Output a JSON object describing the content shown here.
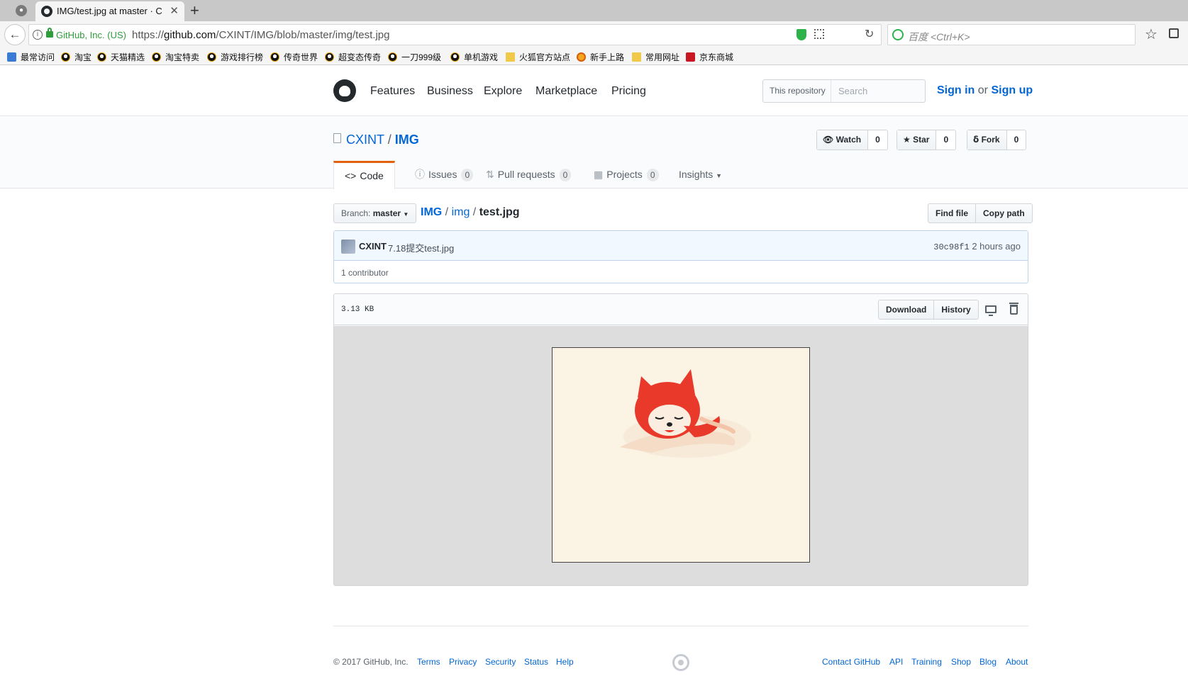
{
  "browser": {
    "tab_title": "IMG/test.jpg at master · C",
    "site_identity": "GitHub, Inc. (US)",
    "url_prefix": "https://",
    "url_host": "github.com",
    "url_path": "/CXINT/IMG/blob/master/img/test.jpg",
    "search_placeholder": "百度 <Ctrl+K>",
    "bookmarks": [
      "最常访问",
      "淘宝",
      "天猫精选",
      "淘宝特卖",
      "游戏排行榜",
      "传奇世界",
      "超变态传奇",
      "一刀999级",
      "单机游戏",
      "火狐官方站点",
      "新手上路",
      "常用网址",
      "京东商城"
    ]
  },
  "header": {
    "nav": [
      "Features",
      "Business",
      "Explore",
      "Marketplace",
      "Pricing"
    ],
    "search_scope": "This repository",
    "search_placeholder": "Search",
    "sign_in": "Sign in",
    "or": "or",
    "sign_up": "Sign up"
  },
  "repo": {
    "owner": "CXINT",
    "separator": "/",
    "name": "IMG",
    "watch_label": "Watch",
    "watch_count": "0",
    "star_label": "Star",
    "star_count": "0",
    "fork_label": "Fork",
    "fork_count": "0",
    "tabs": {
      "code": "Code",
      "issues": "Issues",
      "issues_count": "0",
      "pulls": "Pull requests",
      "pulls_count": "0",
      "projects": "Projects",
      "projects_count": "0",
      "insights": "Insights"
    }
  },
  "file_nav": {
    "branch_prefix": "Branch:",
    "branch": "master",
    "crumb_root": "IMG",
    "crumb_dir": "img",
    "crumb_file": "test.jpg",
    "find_file": "Find file",
    "copy_path": "Copy path"
  },
  "commit": {
    "author": "CXINT",
    "message": "7.18提交test.jpg",
    "sha": "30c98f1",
    "time": "2 hours ago",
    "contributors": "1 contributor"
  },
  "file": {
    "size": "3.13 KB",
    "download": "Download",
    "history": "History"
  },
  "footer": {
    "copyright": "© 2017 GitHub, Inc.",
    "left_links": [
      "Terms",
      "Privacy",
      "Security",
      "Status",
      "Help"
    ],
    "right_links": [
      "Contact GitHub",
      "API",
      "Training",
      "Shop",
      "Blog",
      "About"
    ]
  },
  "colors": {
    "link": "#0366d6",
    "tab_accent": "#e36209",
    "text": "#24292e",
    "muted": "#586069",
    "secure_green": "#2d9e3a"
  }
}
